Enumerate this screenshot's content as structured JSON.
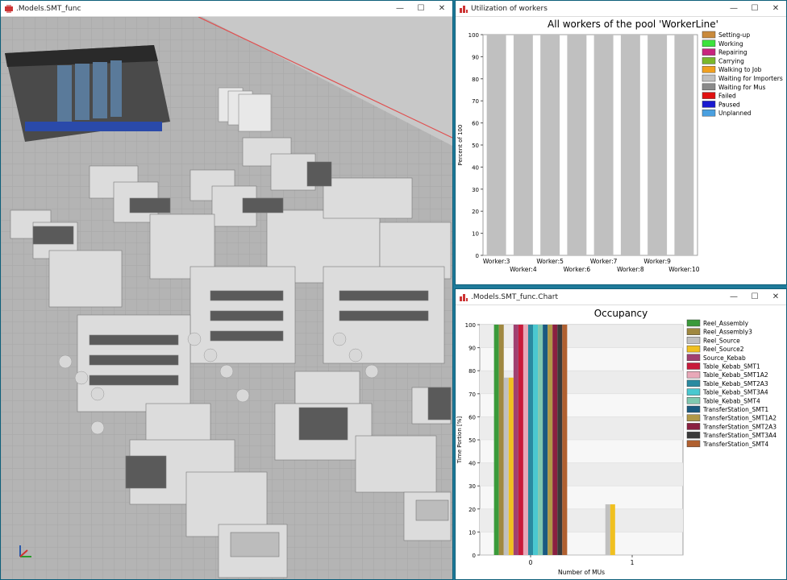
{
  "windows": {
    "model": {
      "title": ".Models.SMT_func"
    },
    "utilization": {
      "title": "Utilization of workers"
    },
    "occupancy": {
      "title": ".Models.SMT_func.Chart"
    }
  },
  "controls": {
    "minimize": "—",
    "maximize": "☐",
    "close": "✕"
  },
  "icons": {
    "app": "model-icon",
    "axes": "axis-triad-icon"
  },
  "colors": {
    "desktop": "#1f7a9a",
    "floor": "#b7b7b7",
    "bar_gray": "#c0c0c0"
  },
  "utilization_chart": {
    "chart_data": {
      "type": "bar",
      "title": "All workers of the pool 'WorkerLine'",
      "ylabel": "Percent of 100",
      "xlabel": "",
      "ylim": [
        0,
        100
      ],
      "yticks": [
        0,
        10,
        20,
        30,
        40,
        50,
        60,
        70,
        80,
        90,
        100
      ],
      "categories": [
        "Worker:3",
        "Worker:4",
        "Worker:5",
        "Worker:6",
        "Worker:7",
        "Worker:8",
        "Worker:9",
        "Worker:10"
      ],
      "series": [
        {
          "name": "Waiting for Importers",
          "color": "#c0c0c0",
          "values": [
            100,
            100,
            100,
            100,
            100,
            100,
            100,
            100
          ]
        }
      ],
      "legend": [
        {
          "name": "Setting-up",
          "color": "#c98a3c"
        },
        {
          "name": "Working",
          "color": "#3ce33c"
        },
        {
          "name": "Repairing",
          "color": "#c8247e"
        },
        {
          "name": "Carrying",
          "color": "#7ab82c"
        },
        {
          "name": "Walking to Job",
          "color": "#f0a020"
        },
        {
          "name": "Waiting for Importers",
          "color": "#c0c0c0"
        },
        {
          "name": "Waiting for Mus",
          "color": "#8a8a8a"
        },
        {
          "name": "Failed",
          "color": "#e01010"
        },
        {
          "name": "Paused",
          "color": "#1a1ad0"
        },
        {
          "name": "Unplanned",
          "color": "#4aa0e0"
        }
      ],
      "legend_position": "top-right",
      "grid": false
    }
  },
  "occupancy_chart": {
    "chart_data": {
      "type": "bar",
      "title": "Occupancy",
      "xlabel": "Number of MUs",
      "ylabel": "Time Portion [%]",
      "ylim": [
        0,
        100
      ],
      "yticks": [
        0,
        10,
        20,
        30,
        40,
        50,
        60,
        70,
        80,
        90,
        100
      ],
      "categories": [
        "0",
        "1"
      ],
      "series": [
        {
          "name": "Reel_Assembly",
          "color": "#3a9a3a",
          "values": [
            100,
            0
          ]
        },
        {
          "name": "Reel_Assembly3",
          "color": "#a08840",
          "values": [
            100,
            0
          ]
        },
        {
          "name": "Reel_Source",
          "color": "#c0c0c0",
          "values": [
            77,
            22
          ]
        },
        {
          "name": "Reel_Source2",
          "color": "#f0c020",
          "values": [
            77,
            22
          ]
        },
        {
          "name": "Source_Kebab",
          "color": "#a04070",
          "values": [
            100,
            0
          ]
        },
        {
          "name": "Table_Kebab_SMT1",
          "color": "#c81a3a",
          "values": [
            100,
            0
          ]
        },
        {
          "name": "Table_Kebab_SMT1A2",
          "color": "#e8a8b8",
          "values": [
            100,
            0
          ]
        },
        {
          "name": "Table_Kebab_SMT2A3",
          "color": "#2a8aa0",
          "values": [
            100,
            0
          ]
        },
        {
          "name": "Table_Kebab_SMT3A4",
          "color": "#4ac8d0",
          "values": [
            100,
            0
          ]
        },
        {
          "name": "Table_Kebab_SMT4",
          "color": "#80c8b0",
          "values": [
            100,
            0
          ]
        },
        {
          "name": "TransferStation_SMT1",
          "color": "#1a5a80",
          "values": [
            100,
            0
          ]
        },
        {
          "name": "TransferStation_SMT1A2",
          "color": "#b09848",
          "values": [
            100,
            0
          ]
        },
        {
          "name": "TransferStation_SMT2A3",
          "color": "#8a2040",
          "values": [
            100,
            0
          ]
        },
        {
          "name": "TransferStation_SMT3A4",
          "color": "#3a3a3a",
          "values": [
            100,
            0
          ]
        },
        {
          "name": "TransferStation_SMT4",
          "color": "#b06030",
          "values": [
            100,
            0
          ]
        }
      ],
      "legend_position": "right",
      "grid": true
    }
  }
}
